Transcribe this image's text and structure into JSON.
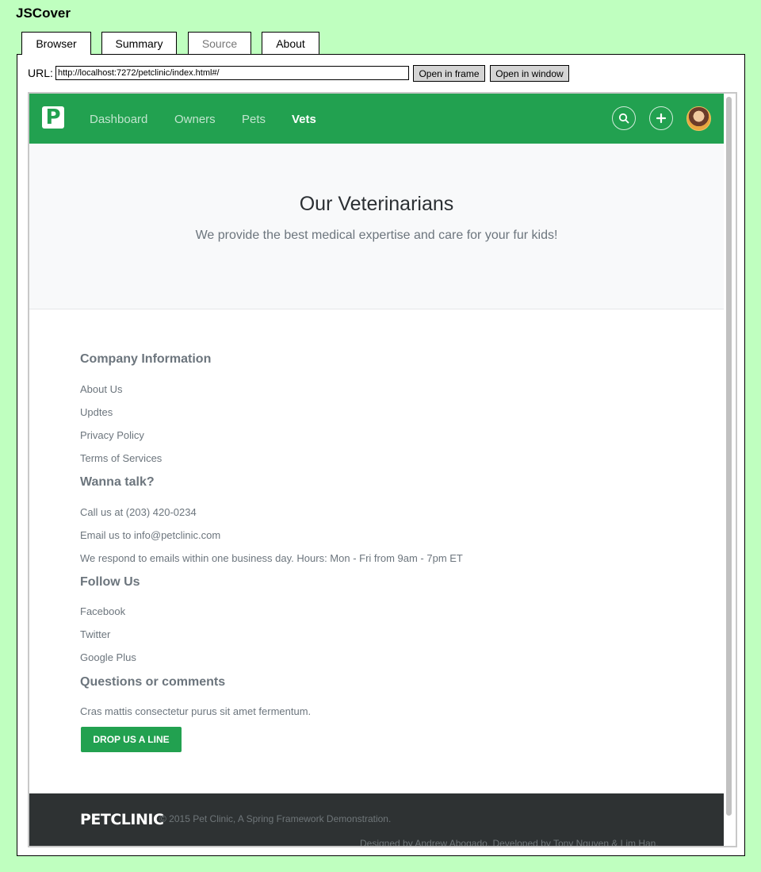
{
  "app_title": "JSCover",
  "tabs": [
    {
      "label": "Browser"
    },
    {
      "label": "Summary"
    },
    {
      "label": "Source"
    },
    {
      "label": "About"
    }
  ],
  "url_bar": {
    "label": "URL:",
    "value": "http://localhost:7272/petclinic/index.html#/",
    "open_frame_label": "Open in frame",
    "open_window_label": "Open in window"
  },
  "site": {
    "logo_letter": "P",
    "nav": [
      "Dashboard",
      "Owners",
      "Pets",
      "Vets"
    ],
    "active_nav": "Vets",
    "hero_title": "Our Veterinarians",
    "hero_subtitle": "We provide the best medical expertise and care for your fur kids!",
    "footer": {
      "company_heading": "Company Information",
      "company_links": [
        "About Us",
        "Updtes",
        "Privacy Policy",
        "Terms of Services"
      ],
      "talk_heading": "Wanna talk?",
      "talk_items": [
        "Call us at (203) 420-0234",
        "Email us to info@petclinic.com",
        "We respond to emails within one business day. Hours: Mon - Fri from 9am - 7pm ET"
      ],
      "follow_heading": "Follow Us",
      "follow_links": [
        "Facebook",
        "Twitter",
        "Google Plus"
      ],
      "questions_heading": "Questions or comments",
      "questions_text": "Cras mattis consectetur purus sit amet fermentum.",
      "drop_button": "DROP US A LINE"
    },
    "bottom": {
      "brand": "PETCLINIC",
      "copyright": "© 2015 Pet Clinic, A Spring Framework Demonstration.",
      "designed": "Designed by Andrew Abogado. Developed by Tony Nguyen & Lim Han."
    }
  },
  "colors": {
    "page_bg": "#bfffbf",
    "brand_green": "#22a150",
    "footer_dark": "#2e3233"
  }
}
